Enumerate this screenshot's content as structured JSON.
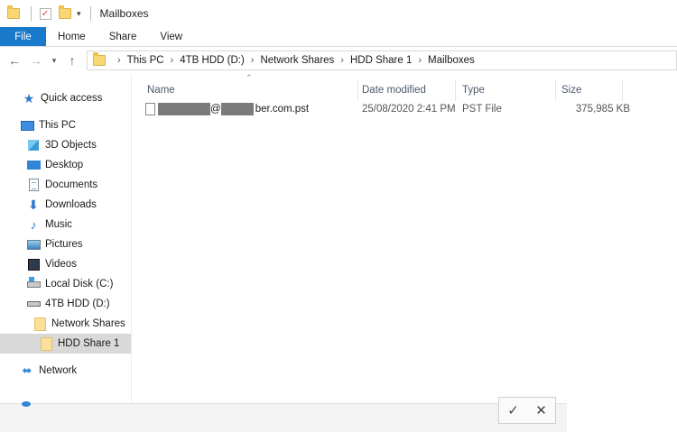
{
  "window": {
    "title": "Mailboxes"
  },
  "ribbon": {
    "tabs": [
      "File",
      "Home",
      "Share",
      "View"
    ]
  },
  "address": {
    "crumbs": [
      "This PC",
      "4TB HDD (D:)",
      "Network Shares",
      "HDD Share 1",
      "Mailboxes"
    ]
  },
  "nav": {
    "items": [
      {
        "label": "Quick access",
        "icon": "quick-access-star-icon"
      },
      {
        "label": "This PC",
        "icon": "this-pc-icon"
      },
      {
        "label": "3D Objects",
        "icon": "3d-objects-icon"
      },
      {
        "label": "Desktop",
        "icon": "desktop-icon"
      },
      {
        "label": "Documents",
        "icon": "documents-icon"
      },
      {
        "label": "Downloads",
        "icon": "downloads-icon"
      },
      {
        "label": "Music",
        "icon": "music-icon"
      },
      {
        "label": "Pictures",
        "icon": "pictures-icon"
      },
      {
        "label": "Videos",
        "icon": "videos-icon"
      },
      {
        "label": "Local Disk (C:)",
        "icon": "local-disk-icon"
      },
      {
        "label": "4TB HDD (D:)",
        "icon": "hdd-icon"
      },
      {
        "label": "Network Shares",
        "icon": "folder-icon"
      },
      {
        "label": "HDD Share 1",
        "icon": "folder-icon",
        "selected": true
      },
      {
        "label": "Network",
        "icon": "network-icon"
      }
    ]
  },
  "columns": {
    "name": "Name",
    "date": "Date modified",
    "type": "Type",
    "size": "Size"
  },
  "files": [
    {
      "name_mid": "@",
      "name_end": "ber.com.pst",
      "date": "25/08/2020 2:41 PM",
      "type": "PST File",
      "size": "375,985 KB"
    }
  ],
  "dialog": {
    "ok": "✓",
    "cancel": "✕"
  }
}
